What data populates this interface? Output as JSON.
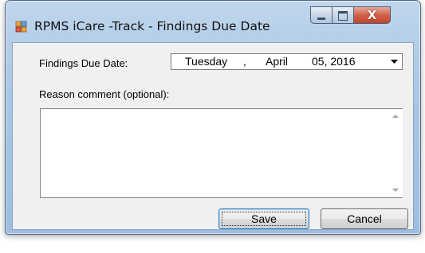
{
  "window": {
    "title": "RPMS iCare -Track - Findings Due Date",
    "app_icon": "app-icon",
    "controls": {
      "minimize_icon": "minimize-icon",
      "maximize_icon": "maximize-icon",
      "close_symbol": "X"
    }
  },
  "form": {
    "due_date_label": "Findings Due Date:",
    "due_date": {
      "weekday": "Tuesday",
      "sep": ",",
      "month": "April",
      "day_year": "05, 2016"
    },
    "reason_label": "Reason comment (optional):",
    "reason_value": ""
  },
  "buttons": {
    "save_label": "Save",
    "cancel_label": "Cancel"
  },
  "colors": {
    "title_bar": "#a9c6e5",
    "close_button": "#c2432a",
    "client": "#f0f0f0"
  }
}
